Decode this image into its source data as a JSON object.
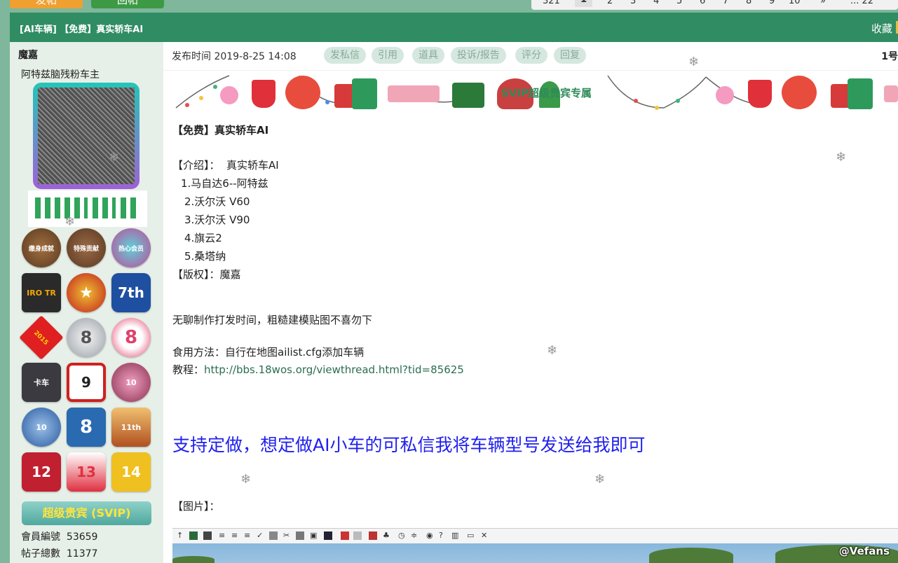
{
  "top": {
    "post_button": "发帖",
    "reply_button": "回帖",
    "pagination": [
      "321",
      "1",
      "2",
      "3",
      "4",
      "5",
      "6",
      "7",
      "8",
      "9",
      "10",
      "»",
      "... 22"
    ],
    "current_page": "1"
  },
  "thread": {
    "title": "[AI车辆] 【免费】真实轿车AI",
    "favorite_label": "收藏"
  },
  "author": {
    "name": "魔嘉",
    "user_title": "阿特兹脑残粉车主",
    "medals": [
      "缴身成就",
      "特殊贡献",
      "热心会员",
      "IRO TR",
      "★",
      "7th",
      "2015",
      "8",
      "8",
      "卡车",
      "9",
      "10",
      "10",
      "8",
      "11th",
      "12",
      "13",
      "14"
    ],
    "vip_badge": "超级贵宾 (SVIP)",
    "member_id_label": "會員編號",
    "member_id": "53659",
    "post_count_label": "帖子總數",
    "post_count": "11377"
  },
  "post": {
    "published": "发布时间 2019-8-25 14:08",
    "actions": [
      "发私信",
      "引用",
      "道具",
      "投诉/报告",
      "评分",
      "回复"
    ],
    "floor": "1号",
    "banner_text": "SVIP超级贵宾专属",
    "heading": "【免费】真实轿车AI",
    "intro_label": "【介绍】：  真实轿车AI",
    "cars": [
      "1.马自达6--阿特兹",
      "2.沃尔沃 V60",
      "3.沃尔沃 V90",
      "4.旗云2",
      "5.桑塔纳"
    ],
    "copyright": "【版权】：魔嘉",
    "note": "无聊制作打发时间，粗糙建模贴图不喜勿下",
    "usage": "食用方法：自行在地图ailist.cfg添加车辆",
    "tutorial_label": "教程：",
    "tutorial_url": "http://bbs.18wos.org/viewthread.html?tid=85625",
    "custom_note": "支持定做，想定做AI小车的可私信我将车辆型号发送给我即可",
    "images_label": "【图片】："
  },
  "watermark": "@Vefans",
  "colors": {
    "page_bg": "#7eb79b",
    "title_bar": "#2f8c63",
    "sidebar_bg": "#e6efe8",
    "link": "#2b6d50",
    "highlight_text": "#1f1fee",
    "vip_text": "#ffe53a"
  }
}
